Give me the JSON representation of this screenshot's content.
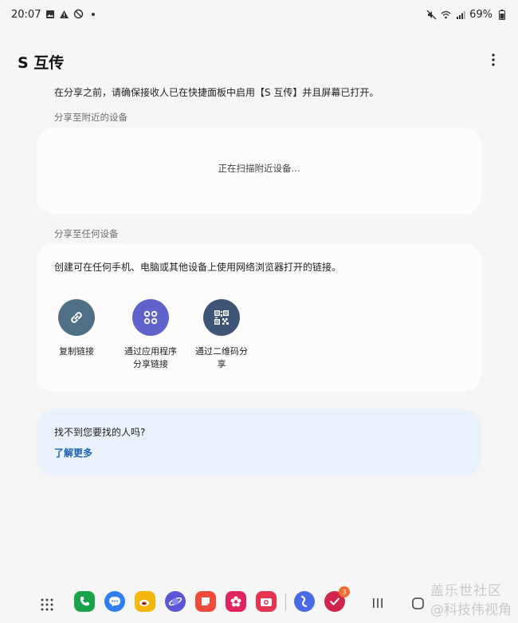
{
  "status_bar": {
    "time": "20:07",
    "battery": "69%",
    "left_icons": [
      "image-icon",
      "warning-icon",
      "blocked-icon",
      "dot-icon"
    ],
    "right_icons": [
      "mute-icon",
      "wifi-icon",
      "signal-icon",
      "battery-icon"
    ]
  },
  "header": {
    "title": "S 互传",
    "more_icon": "more-vert-icon"
  },
  "intro_text": "在分享之前，请确保接收人已在快捷面板中启用【S 互传】并且屏幕已打开。",
  "nearby": {
    "section_label": "分享至附近的设备",
    "scanning_text": "正在扫描附近设备..."
  },
  "any_device": {
    "section_label": "分享至任何设备",
    "description": "创建可在任何手机、电脑或其他设备上使用网络浏览器打开的链接。",
    "options": [
      {
        "label_line1": "复制链接",
        "label_line2": "",
        "icon": "link-icon",
        "color": "#4f6f86"
      },
      {
        "label_line1": "通过应用程序",
        "label_line2": "分享链接",
        "icon": "apps-icon",
        "color": "#5f63c9"
      },
      {
        "label_line1": "通过二维码分",
        "label_line2": "享",
        "icon": "qr-code-icon",
        "color": "#3f5577"
      }
    ]
  },
  "help": {
    "question": "找不到您要找的人吗?",
    "link": "了解更多"
  },
  "taskbar": {
    "apps": [
      {
        "name": "phone-app",
        "color": "#1aa34a"
      },
      {
        "name": "messages-app",
        "color": "#2f7ff2"
      },
      {
        "name": "weibo-app",
        "color": "#f5b70e"
      },
      {
        "name": "internet-app",
        "color": "#5b56d6"
      },
      {
        "name": "notes-app",
        "color": "#f04a3a"
      },
      {
        "name": "gallery-app",
        "color": "#e0245e"
      },
      {
        "name": "camera-app",
        "color": "#e8354f"
      },
      {
        "name": "quick-share-app",
        "color": "#4b6be6"
      },
      {
        "name": "tasks-app",
        "color": "#d0244c"
      }
    ],
    "tasks_badge": "3",
    "watermark_line1": "盖乐世社区",
    "watermark_line2": "@科技伟视角"
  }
}
